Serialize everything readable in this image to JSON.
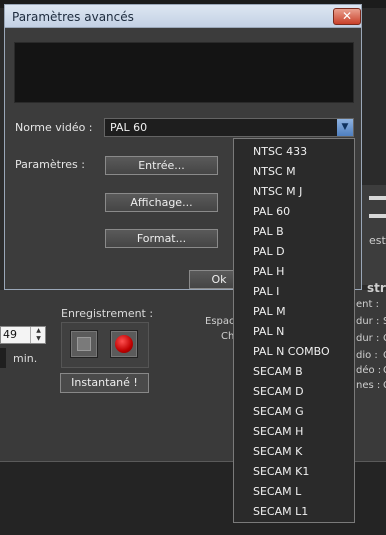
{
  "dialog": {
    "title": "Paramètres avancés",
    "close_label": "✕",
    "video_norm_label": "Norme vidéo :",
    "video_norm_value": "PAL 60",
    "params_label": "Paramètres :",
    "input_button": "Entrée...",
    "display_button": "Affichage...",
    "format_button": "Format...",
    "ok_button": "Ok"
  },
  "dropdown_options": [
    "NTSC 433",
    "NTSC M",
    "NTSC M J",
    "PAL 60",
    "PAL B",
    "PAL D",
    "PAL H",
    "PAL I",
    "PAL M",
    "PAL N",
    "PAL N COMBO",
    "SECAM B",
    "SECAM D",
    "SECAM G",
    "SECAM H",
    "SECAM K",
    "SECAM K1",
    "SECAM L",
    "SECAM L1"
  ],
  "background": {
    "recording_label": "Enregistrement :",
    "snapshot_button": "Instantané !",
    "spin_value": "49",
    "minutes_label": "min.",
    "space_label": "Espace",
    "ch_label": "Ch",
    "right_heading": "stre",
    "right_snippet": "est",
    "right_rows": [
      "ent :",
      "dur :",
      "dur :",
      "dio :",
      "déo :",
      "nes :"
    ],
    "right_row_values": [
      "",
      "S",
      "C",
      "C",
      "C",
      "C"
    ]
  },
  "colors": {
    "dialog_bg": "#3c3c3c",
    "titlebar": "#c3d1e4",
    "close_red": "#c9402a",
    "record_red": "#c00000",
    "dropdown_arrow": "#4f7fc0"
  }
}
